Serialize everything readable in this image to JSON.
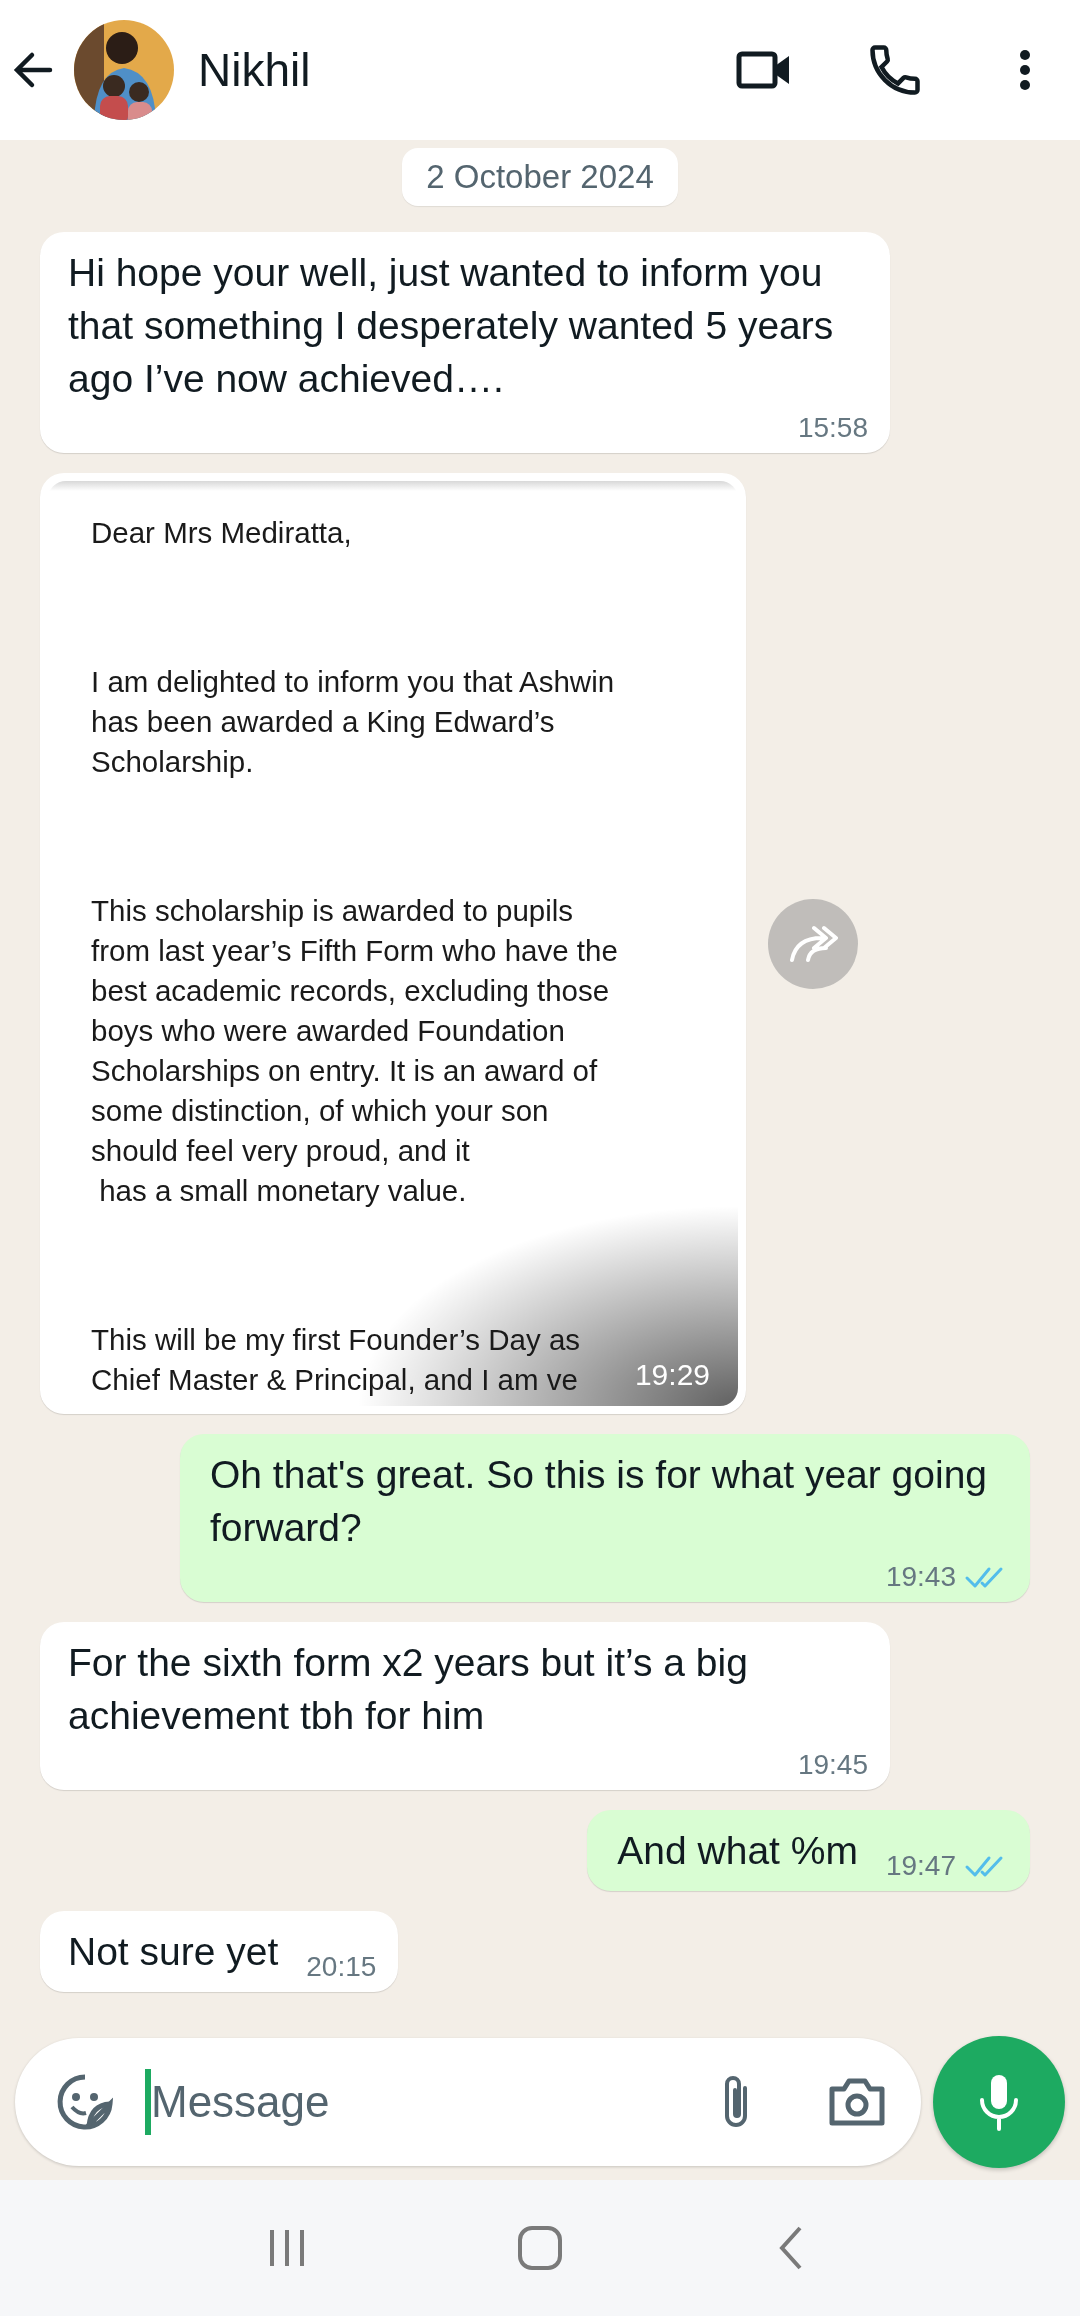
{
  "header": {
    "contact_name": "Nikhil"
  },
  "date_chip": "2 October 2024",
  "messages": [
    {
      "kind": "text",
      "outgoing": false,
      "text": "Hi hope your well, just wanted to inform you that something I desperately wanted 5 years ago I’ve now achieved….",
      "time": "15:58"
    },
    {
      "kind": "document",
      "outgoing": false,
      "paragraphs": [
        "Dear Mrs Mediratta,",
        "I am delighted to inform you that Ashwin\nhas been awarded a King Edward’s\nScholarship.",
        "This scholarship is awarded to pupils\nfrom last year’s Fifth Form who have the\nbest academic records, excluding those\nboys who were awarded Foundation\nScholarships on entry. It is an award of\nsome distinction, of which your son\nshould feel very proud, and it\n has a small monetary value.",
        "This will be my first Founder’s Day as\nChief Master & Principal, and I am ve"
      ],
      "time": "19:29"
    },
    {
      "kind": "text",
      "outgoing": true,
      "text": "Oh that's great. So this is for what year going forward?",
      "time": "19:43",
      "read": true
    },
    {
      "kind": "text",
      "outgoing": false,
      "text": "For the sixth form x2 years but it’s a big achievement tbh for him",
      "time": "19:45"
    },
    {
      "kind": "text",
      "outgoing": true,
      "text": "And what %m",
      "time": "19:47",
      "read": true
    },
    {
      "kind": "text",
      "outgoing": false,
      "text": "Not sure yet",
      "time": "20:15"
    }
  ],
  "composer": {
    "placeholder": "Message"
  }
}
